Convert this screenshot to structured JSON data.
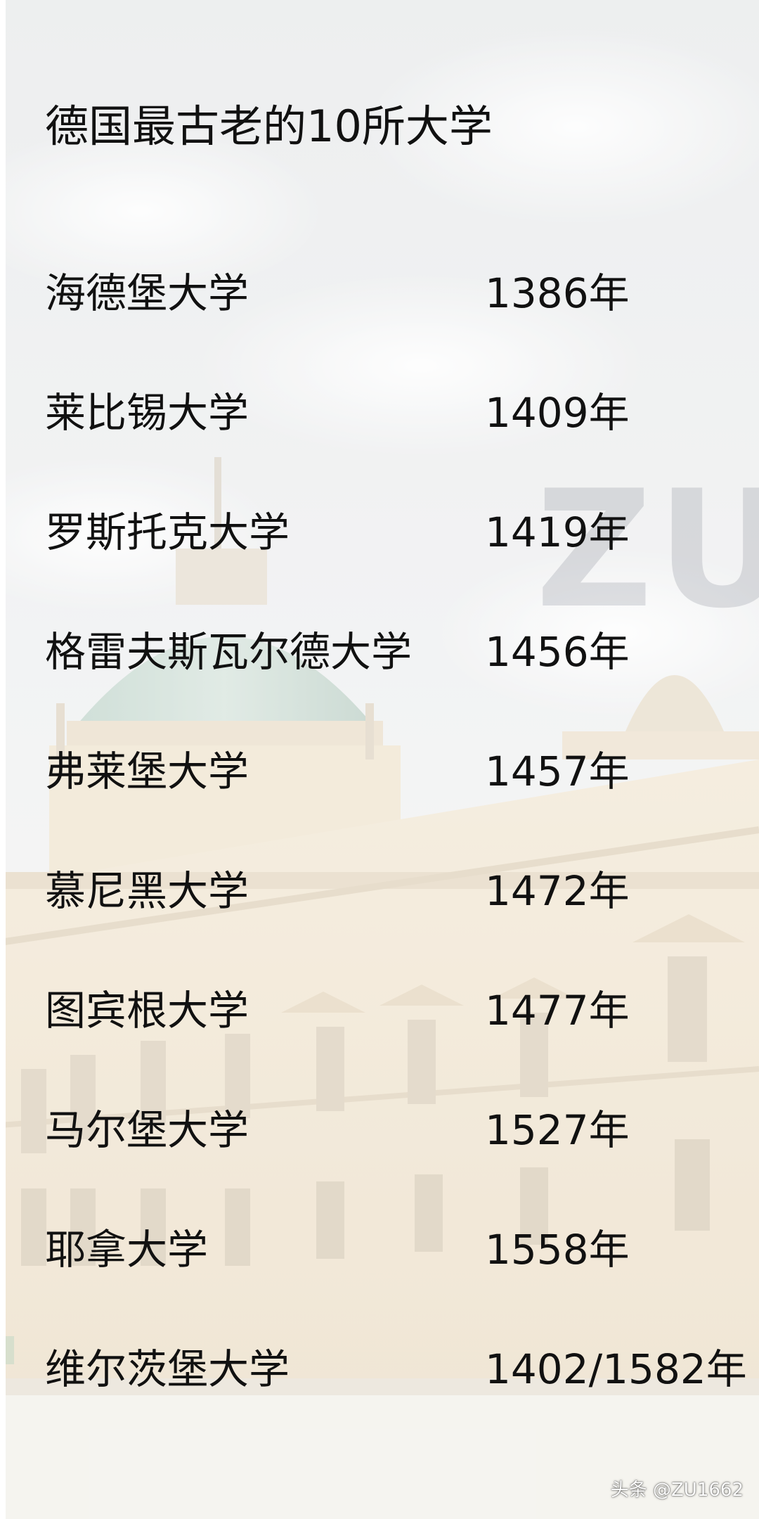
{
  "title": "德国最古老的10所大学",
  "universities": [
    {
      "name": "海德堡大学",
      "year": "1386年"
    },
    {
      "name": "莱比锡大学",
      "year": "1409年"
    },
    {
      "name": "罗斯托克大学",
      "year": "1419年"
    },
    {
      "name": "格雷夫斯瓦尔德大学",
      "year": "1456年"
    },
    {
      "name": "弗莱堡大学",
      "year": "1457年"
    },
    {
      "name": "慕尼黑大学",
      "year": "1472年"
    },
    {
      "name": "图宾根大学",
      "year": "1477年"
    },
    {
      "name": "马尔堡大学",
      "year": "1527年"
    },
    {
      "name": "耶拿大学",
      "year": "1558年"
    },
    {
      "name": "维尔茨堡大学",
      "year": "1402/1582年"
    }
  ],
  "watermark": "ZU",
  "credit": "头条 @ZU1662"
}
